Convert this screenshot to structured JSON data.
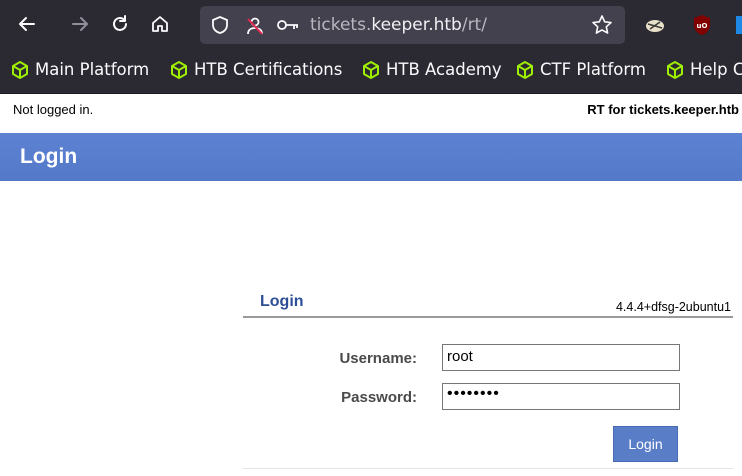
{
  "browser": {
    "url_prefix": "tickets.",
    "url_host": "keeper.htb",
    "url_path": "/rt/",
    "icons": [
      "back-icon",
      "forward-icon",
      "reload-icon",
      "home-icon",
      "shield-icon",
      "no-permission-icon",
      "key-icon",
      "star-icon",
      "extension-icon",
      "ublock-icon"
    ]
  },
  "bookmarks": [
    {
      "label": "Main Platform"
    },
    {
      "label": "HTB Certifications"
    },
    {
      "label": "HTB Academy"
    },
    {
      "label": "CTF Platform"
    },
    {
      "label": "Help C"
    }
  ],
  "page": {
    "status": "Not logged in.",
    "rt_for": "RT for tickets.keeper.htb",
    "title": "Login"
  },
  "login": {
    "title": "Login",
    "version": "4.4.4+dfsg-2ubuntu1",
    "username_label": "Username:",
    "username_value": "root",
    "password_label": "Password:",
    "password_value": "••••••••",
    "submit_label": "Login"
  },
  "colors": {
    "title_bar": "#5b7fcf",
    "accent": "#2e4f95",
    "bookmark_icon": "#9fef00"
  }
}
